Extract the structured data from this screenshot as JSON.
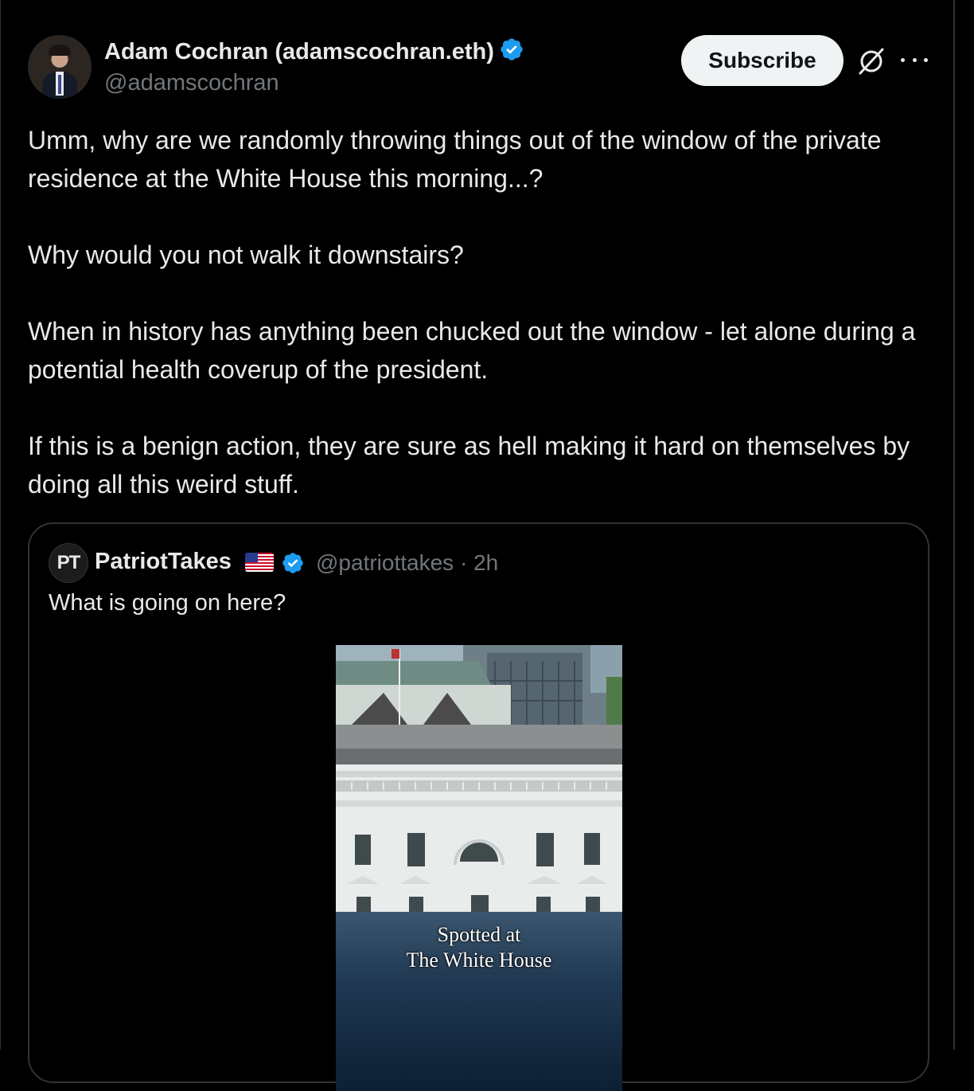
{
  "author": {
    "display_name": "Adam Cochran (adamscochran.eth)",
    "handle": "@adamscochran",
    "verified_icon": "verified-badge-icon"
  },
  "actions": {
    "subscribe_label": "Subscribe",
    "grok_icon": "grok-icon",
    "more_icon": "more-icon"
  },
  "tweet": {
    "paragraphs": [
      "Umm, why are we randomly throwing things out of the window of the private residence at the White House this morning...?",
      "Why would you not walk it downstairs?",
      "When in history has anything been chucked out the window - let alone during a potential health coverup of the president.",
      "If this is a benign action, they are sure as hell making it hard on themselves by doing all this weird stuff."
    ]
  },
  "quote": {
    "avatar_text": "PT",
    "name": "PatriotTakes",
    "flag_icon": "us-flag-icon",
    "handle_time": "@patriottakes · 2h",
    "text": "What is going on here?",
    "media_caption_line1": "Spotted at",
    "media_caption_line2": "The White House"
  },
  "colors": {
    "background": "#000000",
    "text": "#e7e9ea",
    "muted": "#71767b",
    "verified": "#1d9bf0",
    "border": "#2f3336"
  }
}
